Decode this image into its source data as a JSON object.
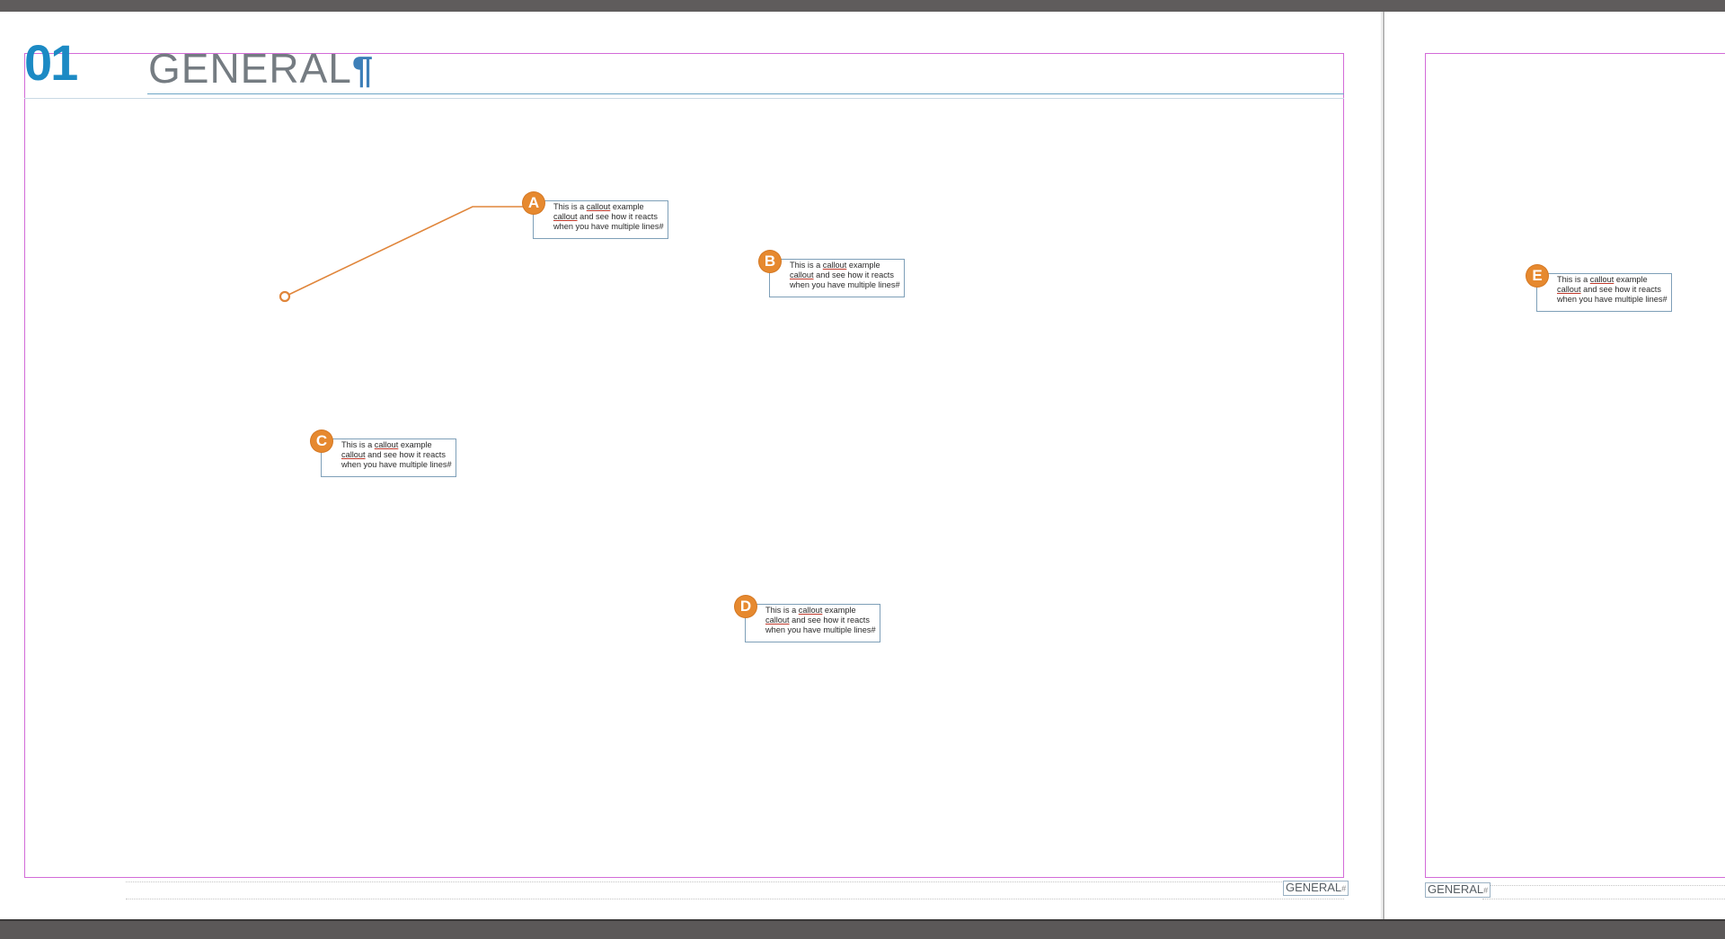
{
  "document": {
    "chapter_number": "01",
    "section_title": "GENERAL",
    "pilcrow": "¶",
    "running_footer_left_page": "GENERAL",
    "running_footer_right_page": "GENERAL",
    "footer_marker_left": "#",
    "footer_marker_right": "#"
  },
  "callout_text": {
    "part1": "This is a ",
    "word_callout_1": "callout",
    "part2": " example ",
    "word_callout_2": "callout",
    "part3": " and see how it reacts when you have multiple lines",
    "end_mark": "#"
  },
  "callouts": [
    {
      "label": "A"
    },
    {
      "label": "B"
    },
    {
      "label": "C"
    },
    {
      "label": "D"
    },
    {
      "label": "E"
    }
  ],
  "colors": {
    "chapter_number": "#1c8ac4",
    "section_title": "#757c82",
    "badge": "#e6892f",
    "leader_line": "#e0853a",
    "margin_guide": "#d36bd8",
    "frame_border": "#7e9fb8"
  }
}
